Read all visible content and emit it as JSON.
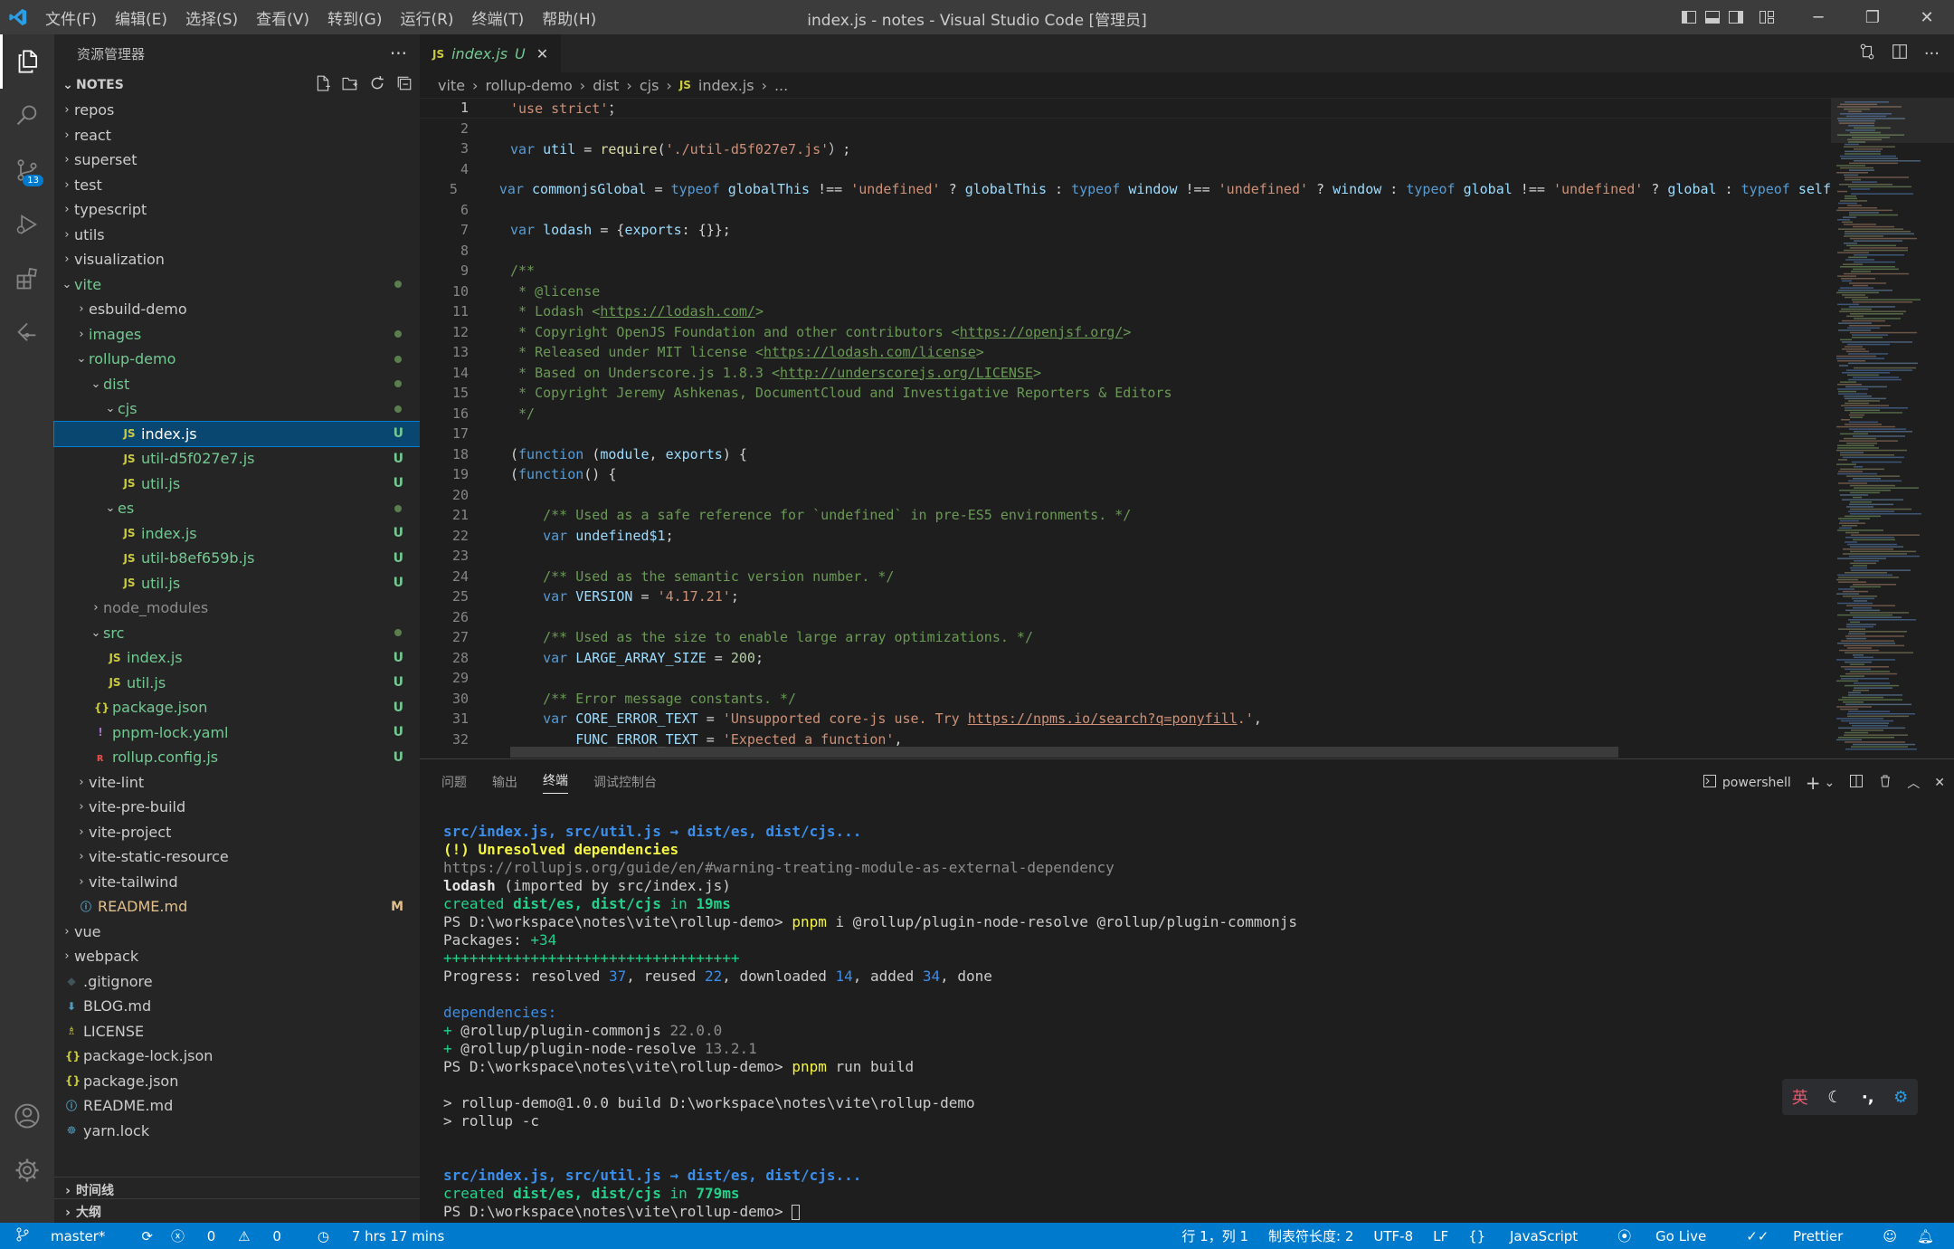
{
  "titlebar": {
    "menu": [
      "文件(F)",
      "编辑(E)",
      "选择(S)",
      "查看(V)",
      "转到(G)",
      "运行(R)",
      "终端(T)",
      "帮助(H)"
    ],
    "title": "index.js - notes - Visual Studio Code [管理员]"
  },
  "activity": {
    "scm_badge": "13"
  },
  "sidebar": {
    "header": "资源管理器",
    "section": "NOTES",
    "timeline": "时间线",
    "outline": "大纲",
    "tree": [
      {
        "name": "repos",
        "kind": "folder",
        "open": false,
        "indent": 1
      },
      {
        "name": "react",
        "kind": "folder",
        "open": false,
        "indent": 1
      },
      {
        "name": "superset",
        "kind": "folder",
        "open": false,
        "indent": 1
      },
      {
        "name": "test",
        "kind": "folder",
        "open": false,
        "indent": 1
      },
      {
        "name": "typescript",
        "kind": "folder",
        "open": false,
        "indent": 1
      },
      {
        "name": "utils",
        "kind": "folder",
        "open": false,
        "indent": 1
      },
      {
        "name": "visualization",
        "kind": "folder",
        "open": false,
        "indent": 1
      },
      {
        "name": "vite",
        "kind": "folder",
        "open": true,
        "indent": 1,
        "dot": true,
        "color": "#73c991"
      },
      {
        "name": "esbuild-demo",
        "kind": "folder",
        "open": false,
        "indent": 2
      },
      {
        "name": "images",
        "kind": "folder",
        "open": false,
        "indent": 2,
        "dot": true,
        "color": "#73c991"
      },
      {
        "name": "rollup-demo",
        "kind": "folder",
        "open": true,
        "indent": 2,
        "dot": true,
        "color": "#73c991"
      },
      {
        "name": "dist",
        "kind": "folder",
        "open": true,
        "indent": 3,
        "dot": true,
        "color": "#73c991"
      },
      {
        "name": "cjs",
        "kind": "folder",
        "open": true,
        "indent": 4,
        "dot": true,
        "color": "#73c991"
      },
      {
        "name": "index.js",
        "kind": "js",
        "indent": 5,
        "status": "U",
        "color": "#73c991",
        "selected": true
      },
      {
        "name": "util-d5f027e7.js",
        "kind": "js",
        "indent": 5,
        "status": "U",
        "color": "#73c991"
      },
      {
        "name": "util.js",
        "kind": "js",
        "indent": 5,
        "status": "U",
        "color": "#73c991"
      },
      {
        "name": "es",
        "kind": "folder",
        "open": true,
        "indent": 4,
        "dot": true,
        "color": "#73c991"
      },
      {
        "name": "index.js",
        "kind": "js",
        "indent": 5,
        "status": "U",
        "color": "#73c991"
      },
      {
        "name": "util-b8ef659b.js",
        "kind": "js",
        "indent": 5,
        "status": "U",
        "color": "#73c991"
      },
      {
        "name": "util.js",
        "kind": "js",
        "indent": 5,
        "status": "U",
        "color": "#73c991"
      },
      {
        "name": "node_modules",
        "kind": "folder",
        "open": false,
        "indent": 3,
        "color": "#8c8c8c"
      },
      {
        "name": "src",
        "kind": "folder",
        "open": true,
        "indent": 3,
        "dot": true,
        "color": "#73c991"
      },
      {
        "name": "index.js",
        "kind": "js",
        "indent": 4,
        "status": "U",
        "color": "#73c991"
      },
      {
        "name": "util.js",
        "kind": "js",
        "indent": 4,
        "status": "U",
        "color": "#73c991"
      },
      {
        "name": "package.json",
        "kind": "json",
        "indent": 3,
        "status": "U",
        "color": "#73c991"
      },
      {
        "name": "pnpm-lock.yaml",
        "kind": "yaml",
        "indent": 3,
        "status": "U",
        "color": "#73c991"
      },
      {
        "name": "rollup.config.js",
        "kind": "rollup",
        "indent": 3,
        "status": "U",
        "color": "#73c991"
      },
      {
        "name": "vite-lint",
        "kind": "folder",
        "open": false,
        "indent": 2
      },
      {
        "name": "vite-pre-build",
        "kind": "folder",
        "open": false,
        "indent": 2
      },
      {
        "name": "vite-project",
        "kind": "folder",
        "open": false,
        "indent": 2
      },
      {
        "name": "vite-static-resource",
        "kind": "folder",
        "open": false,
        "indent": 2
      },
      {
        "name": "vite-tailwind",
        "kind": "folder",
        "open": false,
        "indent": 2
      },
      {
        "name": "README.md",
        "kind": "info",
        "indent": 2,
        "status": "M",
        "color": "#e2c08d"
      },
      {
        "name": "vue",
        "kind": "folder",
        "open": false,
        "indent": 1
      },
      {
        "name": "webpack",
        "kind": "folder",
        "open": false,
        "indent": 1
      },
      {
        "name": ".gitignore",
        "kind": "git",
        "indent": 1
      },
      {
        "name": "BLOG.md",
        "kind": "md",
        "indent": 1
      },
      {
        "name": "LICENSE",
        "kind": "license",
        "indent": 1
      },
      {
        "name": "package-lock.json",
        "kind": "json",
        "indent": 1
      },
      {
        "name": "package.json",
        "kind": "json",
        "indent": 1
      },
      {
        "name": "README.md",
        "kind": "info",
        "indent": 1
      },
      {
        "name": "yarn.lock",
        "kind": "yarn",
        "indent": 1
      }
    ]
  },
  "editor": {
    "tab": {
      "label": "index.js",
      "status": "U"
    },
    "breadcrumb": [
      "vite",
      "rollup-demo",
      "dist",
      "cjs",
      "index.js",
      "..."
    ],
    "lines": [
      [
        [
          "str",
          "'use strict'"
        ],
        [
          "",
          "；"
        ]
      ],
      [],
      [
        [
          "kw",
          "var "
        ],
        [
          "var",
          "util"
        ],
        [
          "",
          " = "
        ],
        [
          "fn",
          "require"
        ],
        [
          "",
          "("
        ],
        [
          "str",
          "'./util-d5f027e7.js'"
        ],
        [
          "",
          "）;"
        ]
      ],
      [],
      [
        [
          "kw",
          "var "
        ],
        [
          "var",
          "commonjsGlobal"
        ],
        [
          "",
          " = "
        ],
        [
          "kw",
          "typeof "
        ],
        [
          "var",
          "globalThis"
        ],
        [
          "",
          " !== "
        ],
        [
          "str",
          "'undefined'"
        ],
        [
          "",
          " ? "
        ],
        [
          "var",
          "globalThis"
        ],
        [
          "",
          " : "
        ],
        [
          "kw",
          "typeof "
        ],
        [
          "var",
          "window"
        ],
        [
          "",
          " !== "
        ],
        [
          "str",
          "'undefined'"
        ],
        [
          "",
          " ? "
        ],
        [
          "var",
          "window"
        ],
        [
          "",
          " : "
        ],
        [
          "kw",
          "typeof "
        ],
        [
          "var",
          "global"
        ],
        [
          "",
          " !== "
        ],
        [
          "str",
          "'undefined'"
        ],
        [
          "",
          " ? "
        ],
        [
          "var",
          "global"
        ],
        [
          "",
          " : "
        ],
        [
          "kw",
          "typeof "
        ],
        [
          "var",
          "self"
        ]
      ],
      [],
      [
        [
          "kw",
          "var "
        ],
        [
          "var",
          "lodash"
        ],
        [
          "",
          " = {"
        ],
        [
          "var",
          "exports"
        ],
        [
          "",
          ": {}};"
        ]
      ],
      [],
      [
        [
          "cm",
          "/**"
        ]
      ],
      [
        [
          "cm",
          " * @license"
        ]
      ],
      [
        [
          "cm",
          " * Lodash <"
        ],
        [
          "cm url",
          "https://lodash.com/"
        ],
        [
          "cm",
          ">"
        ]
      ],
      [
        [
          "cm",
          " * Copyright OpenJS Foundation and other contributors <"
        ],
        [
          "cm url",
          "https://openjsf.org/"
        ],
        [
          "cm",
          ">"
        ]
      ],
      [
        [
          "cm",
          " * Released under MIT license <"
        ],
        [
          "cm url",
          "https://lodash.com/license"
        ],
        [
          "cm",
          ">"
        ]
      ],
      [
        [
          "cm",
          " * Based on Underscore.js 1.8.3 <"
        ],
        [
          "cm url",
          "http://underscorejs.org/LICENSE"
        ],
        [
          "cm",
          ">"
        ]
      ],
      [
        [
          "cm",
          " * Copyright Jeremy Ashkenas, DocumentCloud and Investigative Reporters & Editors"
        ]
      ],
      [
        [
          "cm",
          " */"
        ]
      ],
      [],
      [
        [
          "",
          "("
        ],
        [
          "kw",
          "function "
        ],
        [
          "",
          "("
        ],
        [
          "var",
          "module"
        ],
        [
          "",
          ", "
        ],
        [
          "var",
          "exports"
        ],
        [
          "",
          ") {"
        ]
      ],
      [
        [
          "",
          "("
        ],
        [
          "kw",
          "function"
        ],
        [
          "",
          "() {"
        ]
      ],
      [],
      [
        [
          "",
          "    "
        ],
        [
          "cm",
          "/** Used as a safe reference for `undefined` in pre-ES5 environments. */"
        ]
      ],
      [
        [
          "",
          "    "
        ],
        [
          "kw",
          "var "
        ],
        [
          "var",
          "undefined$1"
        ],
        [
          "",
          ";"
        ]
      ],
      [],
      [
        [
          "",
          "    "
        ],
        [
          "cm",
          "/** Used as the semantic version number. */"
        ]
      ],
      [
        [
          "",
          "    "
        ],
        [
          "kw",
          "var "
        ],
        [
          "var",
          "VERSION"
        ],
        [
          "",
          " = "
        ],
        [
          "str",
          "'4.17.21'"
        ],
        [
          "",
          ";"
        ]
      ],
      [],
      [
        [
          "",
          "    "
        ],
        [
          "cm",
          "/** Used as the size to enable large array optimizations. */"
        ]
      ],
      [
        [
          "",
          "    "
        ],
        [
          "kw",
          "var "
        ],
        [
          "var",
          "LARGE_ARRAY_SIZE"
        ],
        [
          "",
          " = "
        ],
        [
          "num",
          "200"
        ],
        [
          "",
          ";"
        ]
      ],
      [],
      [
        [
          "",
          "    "
        ],
        [
          "cm",
          "/** Error message constants. */"
        ]
      ],
      [
        [
          "",
          "    "
        ],
        [
          "kw",
          "var "
        ],
        [
          "var",
          "CORE_ERROR_TEXT"
        ],
        [
          "",
          " = "
        ],
        [
          "str",
          "'Unsupported core-js use. Try "
        ],
        [
          "str url",
          "https://npms.io/search?q=ponyfill"
        ],
        [
          "str",
          "."
        ],
        [
          "str",
          "'"
        ],
        [
          "",
          ","
        ]
      ],
      [
        [
          "",
          "        "
        ],
        [
          "var",
          "FUNC_ERROR_TEXT"
        ],
        [
          "",
          " = "
        ],
        [
          "str",
          "'Expected a function'"
        ],
        [
          "",
          ","
        ]
      ]
    ]
  },
  "panel": {
    "tabs": [
      "问题",
      "输出",
      "终端",
      "调试控制台"
    ],
    "active": "终端",
    "shell": "powershell",
    "lines": [
      [
        [
          "#3b8eea;font-weight:bold",
          "src/index.js, src/util.js → dist/es, dist/cjs..."
        ]
      ],
      [
        [
          "#f5f543;font-weight:bold",
          "(!) Unresolved dependencies"
        ]
      ],
      [
        [
          "#8c8c8c",
          "https://rollupjs.org/guide/en/#warning-treating-module-as-external-dependency"
        ]
      ],
      [
        [
          "#e5e5e5;font-weight:bold",
          "lodash"
        ],
        [
          "#ccc",
          " (imported by src/index.js)"
        ]
      ],
      [
        [
          "#23d18b",
          "created "
        ],
        [
          "#23d18b;font-weight:bold",
          "dist/es, dist/cjs"
        ],
        [
          "#23d18b",
          " in "
        ],
        [
          "#23d18b;font-weight:bold",
          "19ms"
        ]
      ],
      [
        [
          "#ccc",
          "PS D:\\workspace\\notes\\vite\\rollup-demo> "
        ],
        [
          "#f5f543",
          "pnpm"
        ],
        [
          "#ccc",
          " i @rollup/plugin-node-resolve @rollup/plugin-commonjs"
        ]
      ],
      [
        [
          "#ccc",
          "Packages: "
        ],
        [
          "#23d18b",
          "+34"
        ]
      ],
      [
        [
          "#23d18b",
          "++++++++++++++++++++++++++++++++++"
        ]
      ],
      [
        [
          "#ccc",
          "Progress: resolved "
        ],
        [
          "#3b8eea",
          "37"
        ],
        [
          "#ccc",
          ", reused "
        ],
        [
          "#3b8eea",
          "22"
        ],
        [
          "#ccc",
          ", downloaded "
        ],
        [
          "#3b8eea",
          "14"
        ],
        [
          "#ccc",
          ", added "
        ],
        [
          "#3b8eea",
          "34"
        ],
        [
          "#ccc",
          ", done"
        ]
      ],
      [],
      [
        [
          "#3b8eea",
          "dependencies:"
        ]
      ],
      [
        [
          "#23d18b",
          "+ "
        ],
        [
          "#ccc",
          "@rollup/plugin-commonjs "
        ],
        [
          "#8c8c8c",
          "22.0.0"
        ]
      ],
      [
        [
          "#23d18b",
          "+ "
        ],
        [
          "#ccc",
          "@rollup/plugin-node-resolve "
        ],
        [
          "#8c8c8c",
          "13.2.1"
        ]
      ],
      [
        [
          "#ccc",
          "PS D:\\workspace\\notes\\vite\\rollup-demo> "
        ],
        [
          "#f5f543",
          "pnpm"
        ],
        [
          "#ccc",
          " run build"
        ]
      ],
      [],
      [
        [
          "#ccc",
          "> rollup-demo@1.0.0 build D:\\workspace\\notes\\vite\\rollup-demo"
        ]
      ],
      [
        [
          "#ccc",
          "> rollup -c"
        ]
      ],
      [],
      [],
      [
        [
          "#3b8eea;font-weight:bold",
          "src/index.js, src/util.js → dist/es, dist/cjs..."
        ]
      ],
      [
        [
          "#23d18b",
          "created "
        ],
        [
          "#23d18b;font-weight:bold",
          "dist/es, dist/cjs"
        ],
        [
          "#23d18b",
          " in "
        ],
        [
          "#23d18b;font-weight:bold",
          "779ms"
        ]
      ],
      [
        [
          "#ccc",
          "PS D:\\workspace\\notes\\vite\\rollup-demo> "
        ],
        [
          "cursor",
          ""
        ]
      ]
    ]
  },
  "ime": {
    "lang": "英"
  },
  "statusbar": {
    "branch": "master*",
    "errors": "0",
    "warnings": "0",
    "time": "7 hrs 17 mins",
    "position": "行 1，列 1",
    "tabsize": "制表符长度: 2",
    "encoding": "UTF-8",
    "eol": "LF",
    "language": "JavaScript",
    "golive": "Go Live",
    "prettier": "Prettier"
  },
  "colors": {
    "accent": "#007acc",
    "selection": "#094771",
    "untracked": "#73c991",
    "modified": "#e2c08d"
  }
}
